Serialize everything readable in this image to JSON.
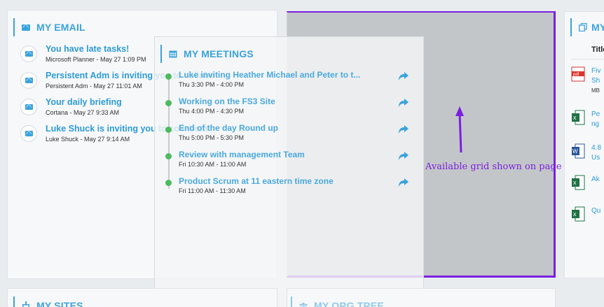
{
  "email": {
    "title": "MY EMAIL",
    "items": [
      {
        "subject": "You have late tasks!",
        "meta": "Microsoft Planner - May 27 1:09 PM"
      },
      {
        "subject": "Persistent Adm is inviting you to collabo",
        "meta": "Persistent Adm - May 27 11:01 AM"
      },
      {
        "subject": "Your daily briefing",
        "meta": "Cortana - May 27 9:33 AM"
      },
      {
        "subject": "Luke Shuck is inviting you to collabora",
        "meta": "Luke Shuck - May 27 9:14 AM"
      }
    ]
  },
  "meetings": {
    "title": "MY MEETINGS",
    "items": [
      {
        "title": "Luke inviting Heather Michael and Peter to t...",
        "time": "Thu 3:30 PM - 4:00 PM"
      },
      {
        "title": "Working on the FS3 Site",
        "time": "Thu 4:00 PM - 4:30 PM"
      },
      {
        "title": "End of the day Round up",
        "time": "Thu 5:00 PM - 5:30 PM"
      },
      {
        "title": "Review with management Team",
        "time": "Fri 10:30 AM - 11:00 AM"
      },
      {
        "title": "Product Scrum at 11 eastern time zone",
        "time": "Fri 11:00 AM - 11:30 AM"
      }
    ]
  },
  "grid": {
    "label": "Available grid shown on page"
  },
  "docs": {
    "title": "MY",
    "column": "Title",
    "items": [
      {
        "type": "pdf",
        "line1": "Fiv",
        "line2": "Sh",
        "line3": "MB"
      },
      {
        "type": "excel",
        "line1": "Pe",
        "line2": "ng",
        "line3": ""
      },
      {
        "type": "word",
        "line1": "4.8",
        "line2": "Us",
        "line3": ""
      },
      {
        "type": "excel",
        "line1": "Ak",
        "line2": "",
        "line3": ""
      },
      {
        "type": "excel",
        "line1": "Qu",
        "line2": "",
        "line3": ""
      }
    ]
  },
  "sites": {
    "title": "MY SITES"
  },
  "orgtree": {
    "title": "MY ORG TREE"
  },
  "colors": {
    "accent": "#3aa3dc",
    "grid_border": "#7a1fe0",
    "timeline_dot": "#4cbb5f"
  }
}
